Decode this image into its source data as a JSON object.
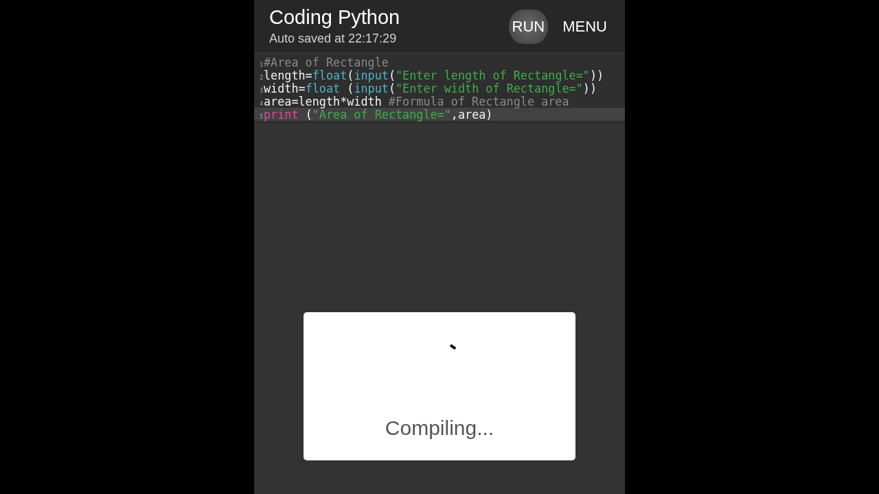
{
  "header": {
    "title": "Coding Python",
    "subtitle": "Auto saved at 22:17:29",
    "buttons": [
      {
        "label": "RUN",
        "pressed": true
      },
      {
        "label": "MENU",
        "pressed": false
      }
    ]
  },
  "editor": {
    "lines": [
      {
        "number": "1",
        "current": false,
        "tokens": [
          {
            "kind": "comment",
            "text": "#Area of Rectangle"
          }
        ]
      },
      {
        "number": "2",
        "current": false,
        "tokens": [
          {
            "kind": "plain",
            "text": "length="
          },
          {
            "kind": "builtin",
            "text": "float"
          },
          {
            "kind": "plain",
            "text": "("
          },
          {
            "kind": "builtin",
            "text": "input"
          },
          {
            "kind": "plain",
            "text": "("
          },
          {
            "kind": "string",
            "text": "\"Enter length of Rectangle=\""
          },
          {
            "kind": "plain",
            "text": "))"
          }
        ]
      },
      {
        "number": "3",
        "current": false,
        "tokens": [
          {
            "kind": "plain",
            "text": "width="
          },
          {
            "kind": "builtin",
            "text": "float"
          },
          {
            "kind": "plain",
            "text": " ("
          },
          {
            "kind": "builtin",
            "text": "input"
          },
          {
            "kind": "plain",
            "text": "("
          },
          {
            "kind": "string",
            "text": "\"Enter width of Rectangle=\""
          },
          {
            "kind": "plain",
            "text": "))"
          }
        ]
      },
      {
        "number": "4",
        "current": false,
        "tokens": [
          {
            "kind": "plain",
            "text": "area=length*width "
          },
          {
            "kind": "comment",
            "text": "#Formula of Rectangle area"
          }
        ]
      },
      {
        "number": "5",
        "current": true,
        "tokens": [
          {
            "kind": "keyword",
            "text": "print"
          },
          {
            "kind": "plain",
            "text": " ("
          },
          {
            "kind": "string",
            "text": "\"Area of Rectangle=\""
          },
          {
            "kind": "plain",
            "text": ",area)"
          }
        ]
      }
    ]
  },
  "dialog": {
    "message": "Compiling..."
  }
}
